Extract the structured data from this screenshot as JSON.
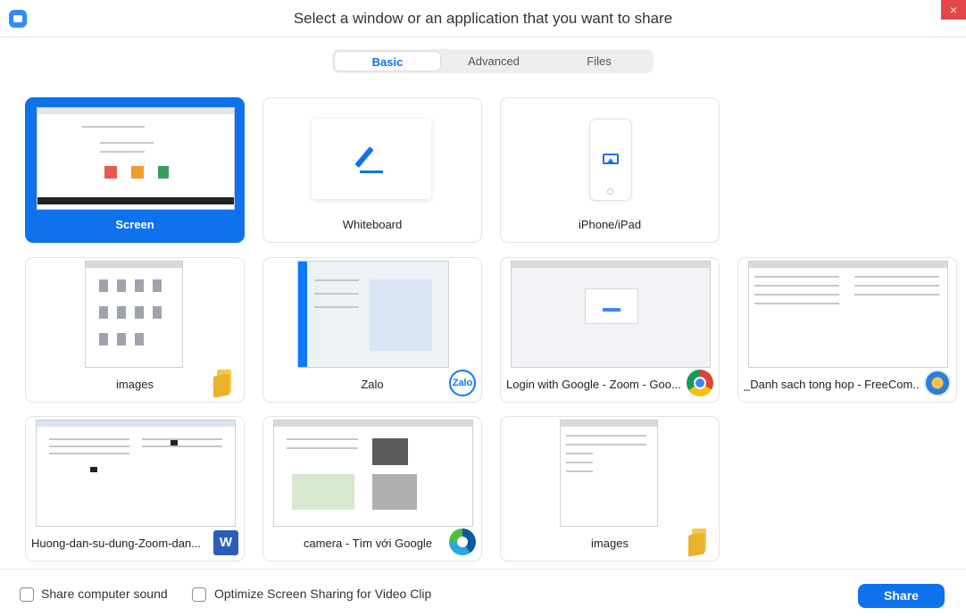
{
  "window": {
    "title": "Select a window or an application that you want to share",
    "close_icon": "close-icon",
    "close_glyph": "×"
  },
  "tabs": [
    {
      "label": "Basic",
      "active": true
    },
    {
      "label": "Advanced",
      "active": false
    },
    {
      "label": "Files",
      "active": false
    }
  ],
  "sources": [
    {
      "label": "Screen",
      "selected": true,
      "badge": "none"
    },
    {
      "label": "Whiteboard",
      "selected": false,
      "badge": "whiteboard-icon"
    },
    {
      "label": "iPhone/iPad",
      "selected": false,
      "badge": "airplay-icon"
    },
    {
      "label": "images",
      "selected": false,
      "badge": "folder-icon"
    },
    {
      "label": "Zalo",
      "selected": false,
      "badge": "zalo-icon",
      "badge_text": "Zalo"
    },
    {
      "label": "Login with Google - Zoom - Goo...",
      "selected": false,
      "badge": "chrome-icon"
    },
    {
      "label": "_Danh sach tong hop - FreeCom...",
      "selected": false,
      "badge": "freecommander-icon"
    },
    {
      "label": "Huong-dan-su-dung-Zoom-dan...",
      "selected": false,
      "badge": "word-icon",
      "badge_text": "W"
    },
    {
      "label": "camera - Tìm với Google",
      "selected": false,
      "badge": "edge-icon"
    },
    {
      "label": "images",
      "selected": false,
      "badge": "folder-icon"
    }
  ],
  "footer": {
    "share_sound_label": "Share computer sound",
    "share_sound_checked": false,
    "optimize_label": "Optimize Screen Sharing for Video Clip",
    "optimize_checked": false,
    "share_button": "Share"
  },
  "colors": {
    "accent": "#0e72ed",
    "close": "#e2454a"
  }
}
